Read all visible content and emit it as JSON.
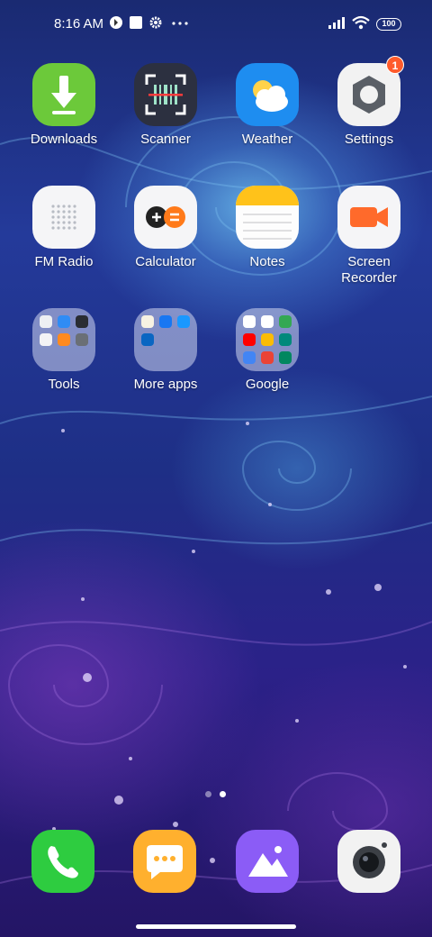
{
  "status_bar": {
    "time": "8:16 AM",
    "battery": "100",
    "icons": [
      "vpn-icon",
      "square-notification-icon",
      "gear-icon",
      "more-dots-icon",
      "signal-icon",
      "wifi-icon",
      "battery-icon"
    ]
  },
  "home_apps": [
    {
      "label": "Downloads",
      "icon": "download-arrow-icon",
      "color": "#6cc93a"
    },
    {
      "label": "Scanner",
      "icon": "barcode-scanner-icon",
      "color": "#2c3040"
    },
    {
      "label": "Weather",
      "icon": "sun-cloud-icon",
      "color": "#1e8df0"
    },
    {
      "label": "Settings",
      "icon": "gear-icon",
      "color": "#f2f2f2",
      "badge": "1"
    },
    {
      "label": "FM Radio",
      "icon": "radio-grille-icon",
      "color": "#f5f5f7"
    },
    {
      "label": "Calculator",
      "icon": "calculator-icon",
      "color": "#f5f5f7"
    },
    {
      "label": "Notes",
      "icon": "notepad-icon",
      "color": "#fdfdfd"
    },
    {
      "label": "Screen Recorder",
      "icon": "video-camera-icon",
      "color": "#f5f5f7"
    }
  ],
  "folders": [
    {
      "label": "Tools"
    },
    {
      "label": "More apps"
    },
    {
      "label": "Google"
    }
  ],
  "page_indicator": {
    "pages": 2,
    "current": 2
  },
  "dock": [
    {
      "name": "phone",
      "icon": "phone-handset-icon",
      "color": "#2ecc40"
    },
    {
      "name": "messaging",
      "icon": "chat-bubble-icon",
      "color": "#ffb02e"
    },
    {
      "name": "gallery",
      "icon": "mountain-photo-icon",
      "color": "#8b5cf6"
    },
    {
      "name": "camera",
      "icon": "camera-lens-icon",
      "color": "#f2f2f2"
    }
  ]
}
